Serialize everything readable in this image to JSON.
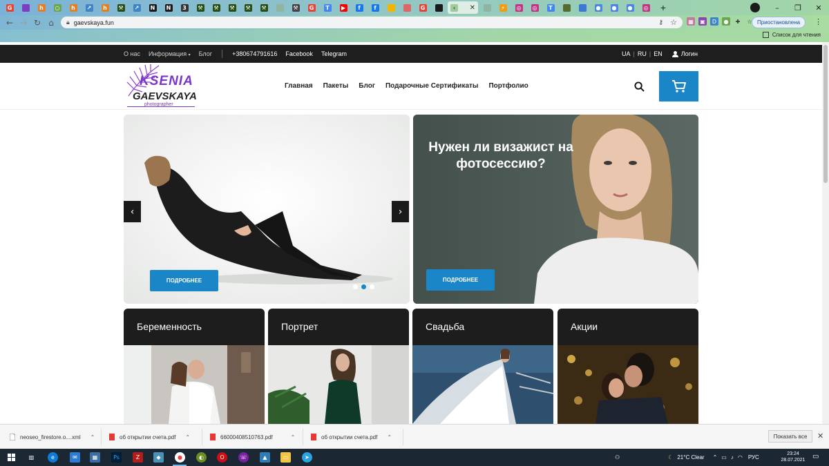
{
  "browser": {
    "tabs": [
      {
        "icon": "google-icon",
        "color": "#ea4335",
        "glyph": "G"
      },
      {
        "icon": "purple-app-icon",
        "color": "#7b3fbf",
        "glyph": ""
      },
      {
        "icon": "h-icon",
        "color": "#e67e22",
        "glyph": "h"
      },
      {
        "icon": "circle-icon",
        "color": "#6aa84f",
        "glyph": "○"
      },
      {
        "icon": "h-icon",
        "color": "#e67e22",
        "glyph": "h"
      },
      {
        "icon": "chart-icon",
        "color": "#3d85c6",
        "glyph": "↗"
      },
      {
        "icon": "h-icon",
        "color": "#e67e22",
        "glyph": "h"
      },
      {
        "icon": "tool-icon",
        "color": "#274e13",
        "glyph": "⚒"
      },
      {
        "icon": "chart-icon",
        "color": "#3d85c6",
        "glyph": "↗"
      },
      {
        "icon": "ns-icon",
        "color": "#1a1a1a",
        "glyph": "N"
      },
      {
        "icon": "ns-icon",
        "color": "#1a1a1a",
        "glyph": "N"
      },
      {
        "icon": "version-icon",
        "color": "#333333",
        "glyph": "3"
      },
      {
        "icon": "tool-icon",
        "color": "#274e13",
        "glyph": "⚒"
      },
      {
        "icon": "tool-icon",
        "color": "#274e13",
        "glyph": "⚒"
      },
      {
        "icon": "tool-icon",
        "color": "#274e13",
        "glyph": "⚒"
      },
      {
        "icon": "tool-icon",
        "color": "#274e13",
        "glyph": "⚒"
      },
      {
        "icon": "tool-icon",
        "color": "#274e13",
        "glyph": "⚒"
      },
      {
        "icon": "blank-icon",
        "color": "#8fb4a0",
        "glyph": ""
      },
      {
        "icon": "hammer-icon",
        "color": "#444444",
        "glyph": "⚒"
      },
      {
        "icon": "google-icon",
        "color": "#ea4335",
        "glyph": "G"
      },
      {
        "icon": "translate-icon",
        "color": "#4285f4",
        "glyph": "T"
      },
      {
        "icon": "youtube-icon",
        "color": "#ff0000",
        "glyph": "▶"
      },
      {
        "icon": "facebook-icon",
        "color": "#1877f2",
        "glyph": "f"
      },
      {
        "icon": "facebook-icon",
        "color": "#1877f2",
        "glyph": "f"
      },
      {
        "icon": "docs-icon",
        "color": "#f4b400",
        "glyph": ""
      },
      {
        "icon": "app-icon",
        "color": "#e06666",
        "glyph": ""
      },
      {
        "icon": "google-icon",
        "color": "#ea4335",
        "glyph": "G"
      },
      {
        "icon": "dark-square-icon",
        "color": "#1a1a1a",
        "glyph": ""
      }
    ],
    "active_tab_icon": "active-tab-icon",
    "tabs_after": [
      {
        "icon": "blank-icon",
        "color": "#8fb4a0",
        "glyph": ""
      },
      {
        "icon": "bolt-icon",
        "color": "#f39c12",
        "glyph": "⚡"
      },
      {
        "icon": "instagram-icon",
        "color": "#c13584",
        "glyph": "◎"
      },
      {
        "icon": "instagram-icon",
        "color": "#c13584",
        "glyph": "◎"
      },
      {
        "icon": "translate-icon",
        "color": "#4285f4",
        "glyph": "T"
      },
      {
        "icon": "cart-icon",
        "color": "#556b2f",
        "glyph": ""
      },
      {
        "icon": "web-icon",
        "color": "#3c78d8",
        "glyph": ""
      },
      {
        "icon": "globe-icon",
        "color": "#4a86e8",
        "glyph": "●"
      },
      {
        "icon": "globe-icon",
        "color": "#4a86e8",
        "glyph": "●"
      },
      {
        "icon": "globe-icon",
        "color": "#4a86e8",
        "glyph": "●"
      },
      {
        "icon": "instagram-icon",
        "color": "#c13584",
        "glyph": "◎"
      }
    ],
    "window_controls": {
      "minimize": "–",
      "maximize": "❐",
      "close": "✕"
    },
    "url": "gaevskaya.fun",
    "paused_label": "Приостановлена",
    "reading_list": "Список для чтения"
  },
  "site": {
    "topbar": {
      "about": "О нас",
      "info": "Информация",
      "blog": "Блог",
      "phone": "+380674791616",
      "facebook": "Facebook",
      "telegram": "Telegram",
      "lang_ua": "UA",
      "lang_ru": "RU",
      "lang_en": "EN",
      "login": "Логин"
    },
    "logo": {
      "line1": "KSENIA",
      "line2": "GAEVSKAYA",
      "line3": "photographer"
    },
    "nav": [
      "Главная",
      "Пакеты",
      "Блог",
      "Подарочные Сертификаты",
      "Портфолио"
    ],
    "hero_left": {
      "button": "ПОДРОБНЕЕ",
      "prev": "‹",
      "next": "›",
      "active_dot": 1
    },
    "hero_right": {
      "title": "Нужен ли визажист на фотосессию?",
      "button": "ПОДРОБНЕЕ"
    },
    "categories": [
      "Беременность",
      "Портрет",
      "Свадьба",
      "Акции"
    ]
  },
  "downloads": {
    "items": [
      "neoseo_firestore.o....xml",
      "об открытии счета.pdf",
      "66000408510763.pdf",
      "об открытии счета.pdf"
    ],
    "show_all": "Показать все"
  },
  "taskbar": {
    "weather": "21°C  Clear",
    "lang": "РУС",
    "time": "23:24",
    "date": "28.07.2021"
  }
}
